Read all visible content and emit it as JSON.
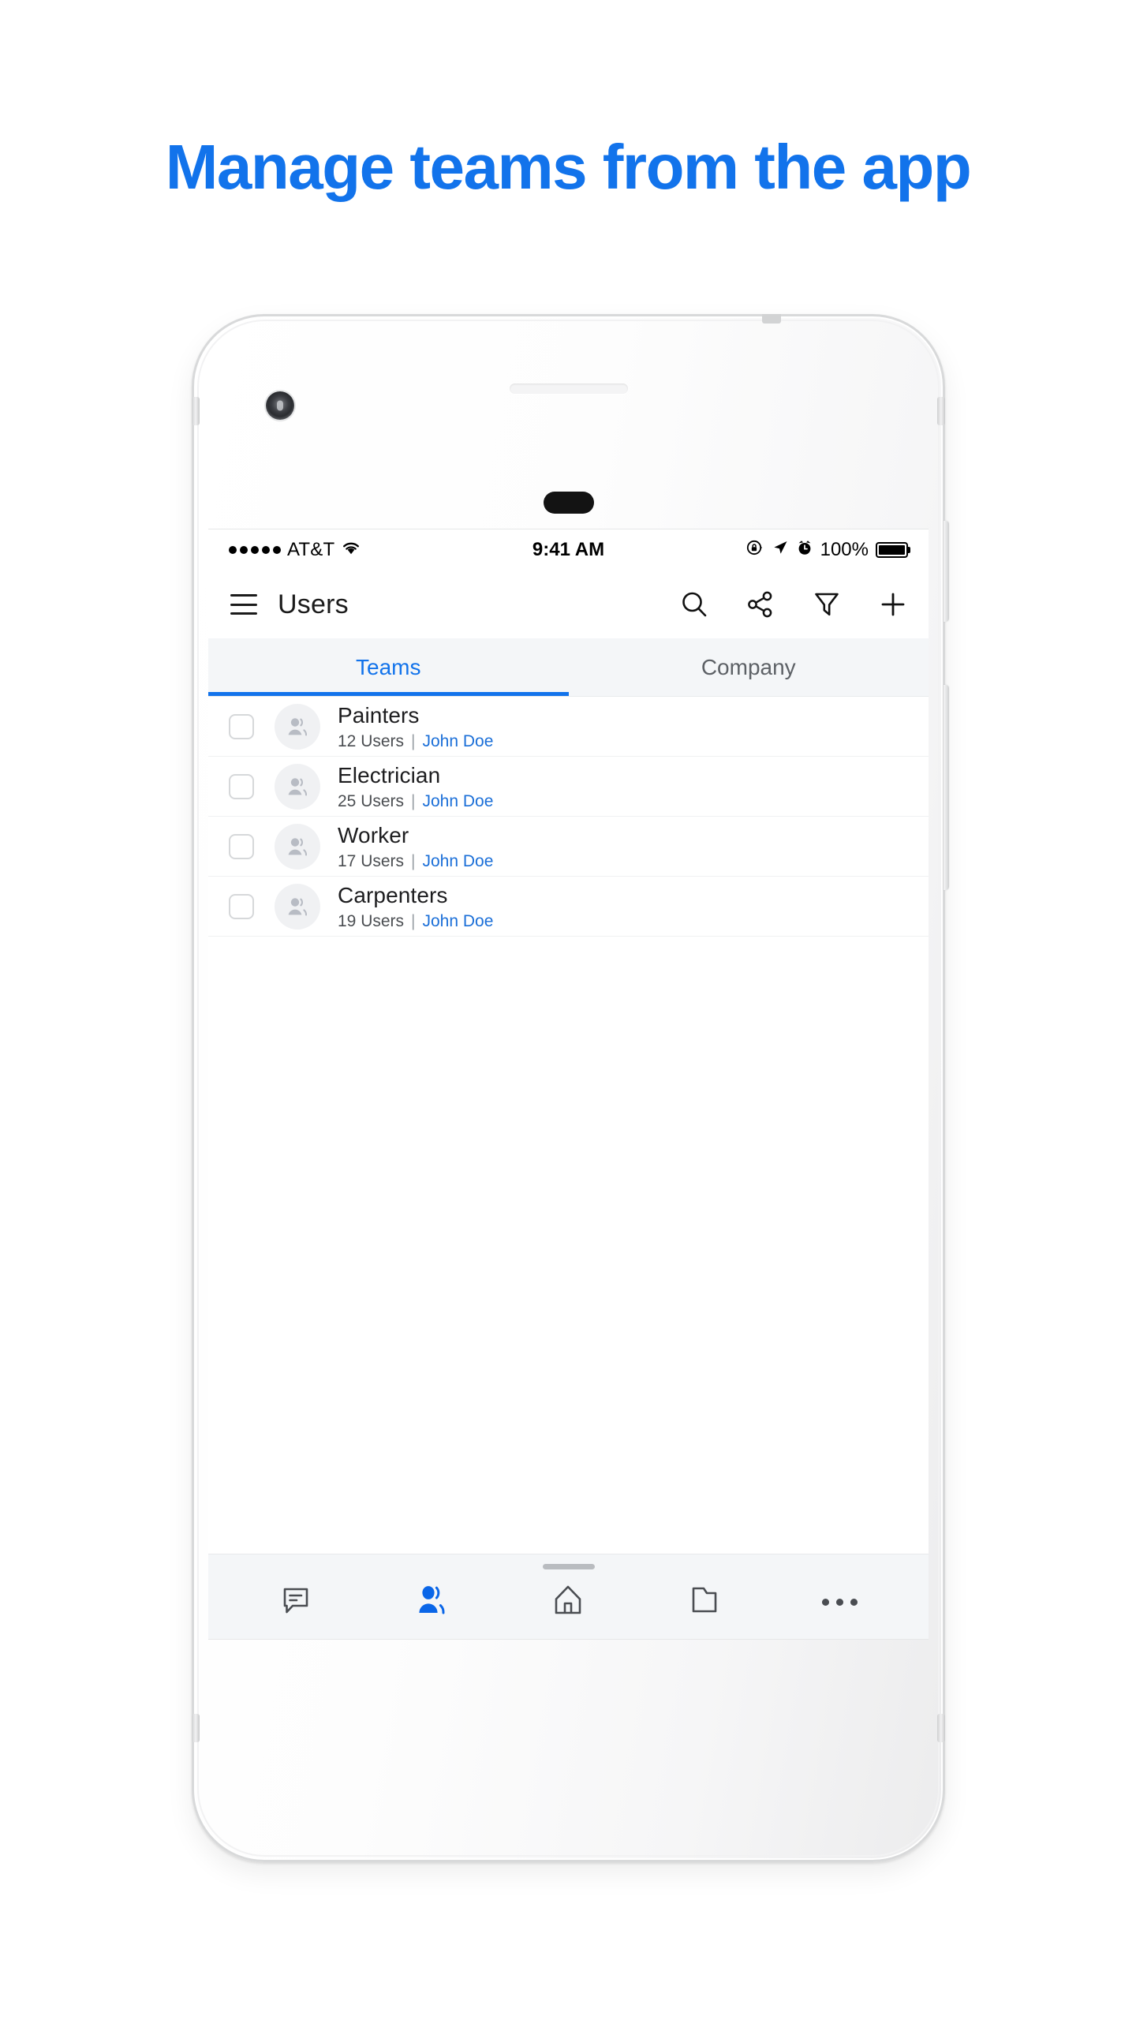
{
  "headline": "Manage teams from the app",
  "theme": {
    "accent": "#1273EB",
    "link": "#1B6FD8",
    "text": "#1d1d1f",
    "muted": "#5d6166",
    "bar_bg": "#f4f6f8"
  },
  "status_bar": {
    "carrier": "AT&T",
    "signal_dots": 5,
    "wifi_icon": "wifi-icon",
    "time": "9:41 AM",
    "rotation_lock_icon": "rotation-lock-icon",
    "location_icon": "location-arrow-icon",
    "alarm_icon": "alarm-clock-icon",
    "battery_percent": "100%",
    "battery_level": 100
  },
  "app_bar": {
    "menu_icon": "hamburger-menu-icon",
    "title": "Users",
    "actions": [
      {
        "name": "search-icon",
        "label": "Search"
      },
      {
        "name": "share-icon",
        "label": "Share"
      },
      {
        "name": "filter-icon",
        "label": "Filter"
      },
      {
        "name": "add-icon",
        "label": "Add"
      }
    ]
  },
  "tabs": [
    {
      "label": "Teams",
      "active": true
    },
    {
      "label": "Company",
      "active": false
    }
  ],
  "list": {
    "rows": [
      {
        "name": "Painters",
        "users": "12 Users",
        "separator": "|",
        "owner": "John Doe",
        "checked": false
      },
      {
        "name": "Electrician",
        "users": "25 Users",
        "separator": "|",
        "owner": "John Doe",
        "checked": false
      },
      {
        "name": "Worker",
        "users": "17 Users",
        "separator": "|",
        "owner": "John Doe",
        "checked": false
      },
      {
        "name": "Carpenters",
        "users": "19 Users",
        "separator": "|",
        "owner": "John Doe",
        "checked": false
      }
    ]
  },
  "bottom_nav": {
    "items": [
      {
        "name": "messages-icon",
        "label": "Messages",
        "active": false
      },
      {
        "name": "people-icon",
        "label": "People",
        "active": true
      },
      {
        "name": "home-icon",
        "label": "Home",
        "active": false
      },
      {
        "name": "folder-icon",
        "label": "Files",
        "active": false
      },
      {
        "name": "more-icon",
        "label": "More",
        "active": false
      }
    ]
  }
}
